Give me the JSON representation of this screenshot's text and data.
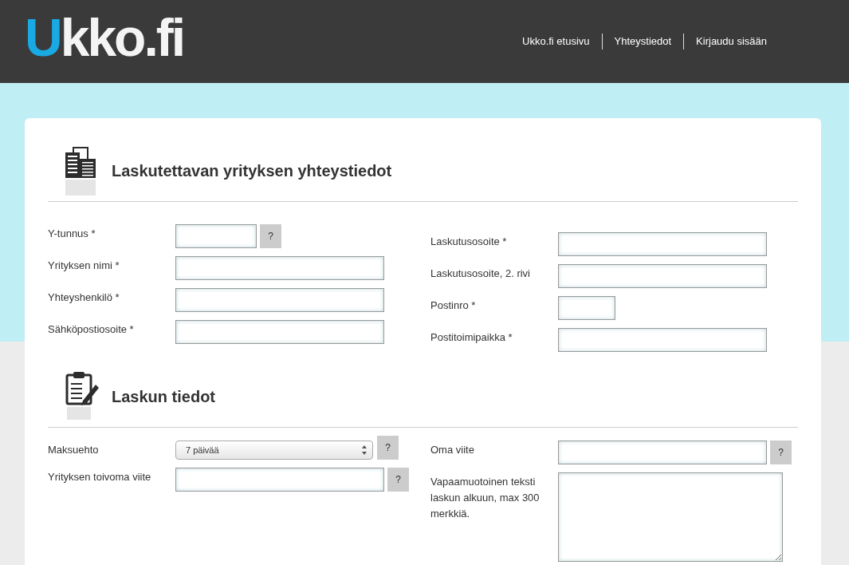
{
  "header": {
    "logo": {
      "accent": "U",
      "rest": "kko.fi"
    },
    "nav": [
      {
        "label": "Ukko.fi etusivu"
      },
      {
        "label": "Yhteystiedot"
      },
      {
        "label": "Kirjaudu sisään"
      }
    ]
  },
  "sections": [
    {
      "title": "Laskutettavan yrityksen yhteystiedot",
      "left": [
        {
          "label": "Y-tunnus *",
          "kind": "text",
          "help": "?"
        },
        {
          "label": "Yrityksen nimi *",
          "kind": "text"
        },
        {
          "label": "Yhteyshenkilö *",
          "kind": "text"
        },
        {
          "label": "Sähköpostiosoite *",
          "kind": "text"
        }
      ],
      "right": [
        {
          "label": "Laskutusosoite *",
          "kind": "text"
        },
        {
          "label": "Laskutusosoite, 2. rivi",
          "kind": "text"
        },
        {
          "label": "Postinro *",
          "kind": "text"
        },
        {
          "label": "Postitoimipaikka *",
          "kind": "text"
        }
      ]
    },
    {
      "title": "Laskun tiedot",
      "left": [
        {
          "label": "Maksuehto",
          "kind": "select",
          "value": "7 päivää",
          "help": "?"
        },
        {
          "label": "Yrityksen toivoma viite",
          "kind": "text",
          "help": "?"
        }
      ],
      "right": [
        {
          "label": "Oma viite",
          "kind": "text",
          "help": "?"
        },
        {
          "label": "Vapaamuotoinen teksti laskun alkuun, max 300 merkkiä.",
          "kind": "textarea"
        }
      ]
    }
  ]
}
